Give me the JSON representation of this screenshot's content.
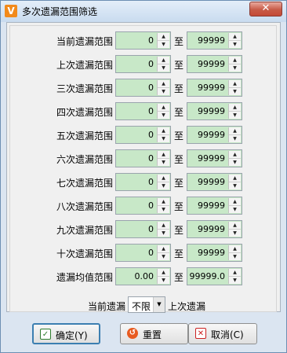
{
  "window": {
    "title": "多次遗漏范围筛选",
    "close_glyph": "✕",
    "app_icon_glyph": "V"
  },
  "connector": "至",
  "rows": [
    {
      "label": "当前遗漏范围",
      "from": "0",
      "to": "99999"
    },
    {
      "label": "上次遗漏范围",
      "from": "0",
      "to": "99999"
    },
    {
      "label": "三次遗漏范围",
      "from": "0",
      "to": "99999"
    },
    {
      "label": "四次遗漏范围",
      "from": "0",
      "to": "99999"
    },
    {
      "label": "五次遗漏范围",
      "from": "0",
      "to": "99999"
    },
    {
      "label": "六次遗漏范围",
      "from": "0",
      "to": "99999"
    },
    {
      "label": "七次遗漏范围",
      "from": "0",
      "to": "99999"
    },
    {
      "label": "八次遗漏范围",
      "from": "0",
      "to": "99999"
    },
    {
      "label": "九次遗漏范围",
      "from": "0",
      "to": "99999"
    },
    {
      "label": "十次遗漏范围",
      "from": "0",
      "to": "99999"
    },
    {
      "label": "遗漏均值范围",
      "from": "0.00",
      "to": "99999.0"
    }
  ],
  "compare": {
    "left_label": "当前遗漏",
    "selected": "不限",
    "right_label": "上次遗漏"
  },
  "buttons": {
    "ok": "确定(Y)",
    "reset": "重置",
    "cancel": "取消(C)"
  },
  "icons": {
    "ok": "check-icon",
    "reset": "reset-icon",
    "cancel": "cancel-icon"
  }
}
